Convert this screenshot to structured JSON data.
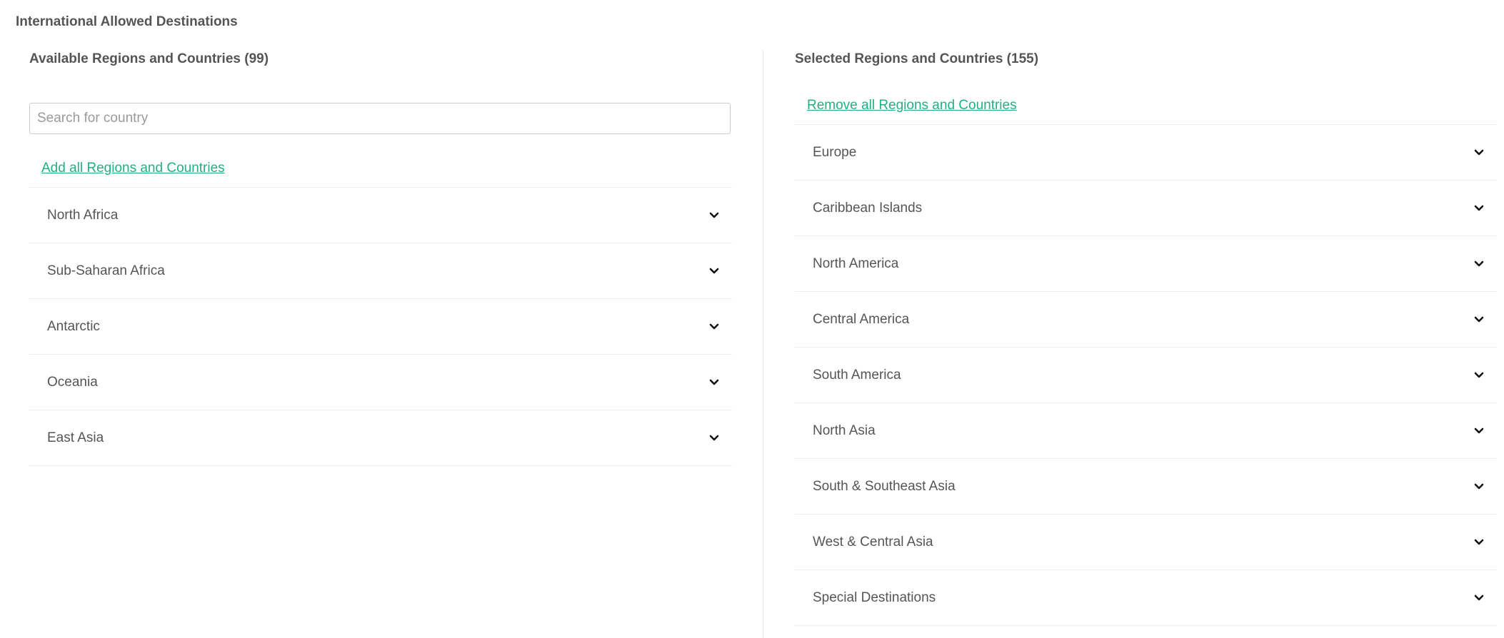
{
  "page": {
    "title": "International Allowed Destinations"
  },
  "available": {
    "heading": "Available Regions and Countries (99)",
    "search_placeholder": "Search for country",
    "search_value": "",
    "add_all_label": "Add all Regions and Countries",
    "regions": [
      {
        "name": "North Africa",
        "icon": "chevron-down-icon"
      },
      {
        "name": "Sub-Saharan Africa",
        "icon": "chevron-down-icon"
      },
      {
        "name": "Antarctic",
        "icon": "chevron-down-icon"
      },
      {
        "name": "Oceania",
        "icon": "chevron-down-icon"
      },
      {
        "name": "East Asia",
        "icon": "chevron-down-icon"
      }
    ]
  },
  "selected": {
    "heading": "Selected Regions and Countries (155)",
    "remove_all_label": "Remove all Regions and Countries",
    "regions": [
      {
        "name": "Europe",
        "icon": "chevron-down-icon"
      },
      {
        "name": "Caribbean Islands",
        "icon": "chevron-down-icon"
      },
      {
        "name": "North America",
        "icon": "chevron-down-icon"
      },
      {
        "name": "Central America",
        "icon": "chevron-down-icon"
      },
      {
        "name": "South America",
        "icon": "chevron-down-icon"
      },
      {
        "name": "North Asia",
        "icon": "chevron-down-icon"
      },
      {
        "name": "South & Southeast Asia",
        "icon": "chevron-down-icon"
      },
      {
        "name": "West & Central Asia",
        "icon": "chevron-down-icon"
      },
      {
        "name": "Special Destinations",
        "icon": "chevron-down-icon"
      }
    ]
  },
  "colors": {
    "link": "#1fb27f",
    "text": "#555555",
    "border": "#eeeeee"
  }
}
